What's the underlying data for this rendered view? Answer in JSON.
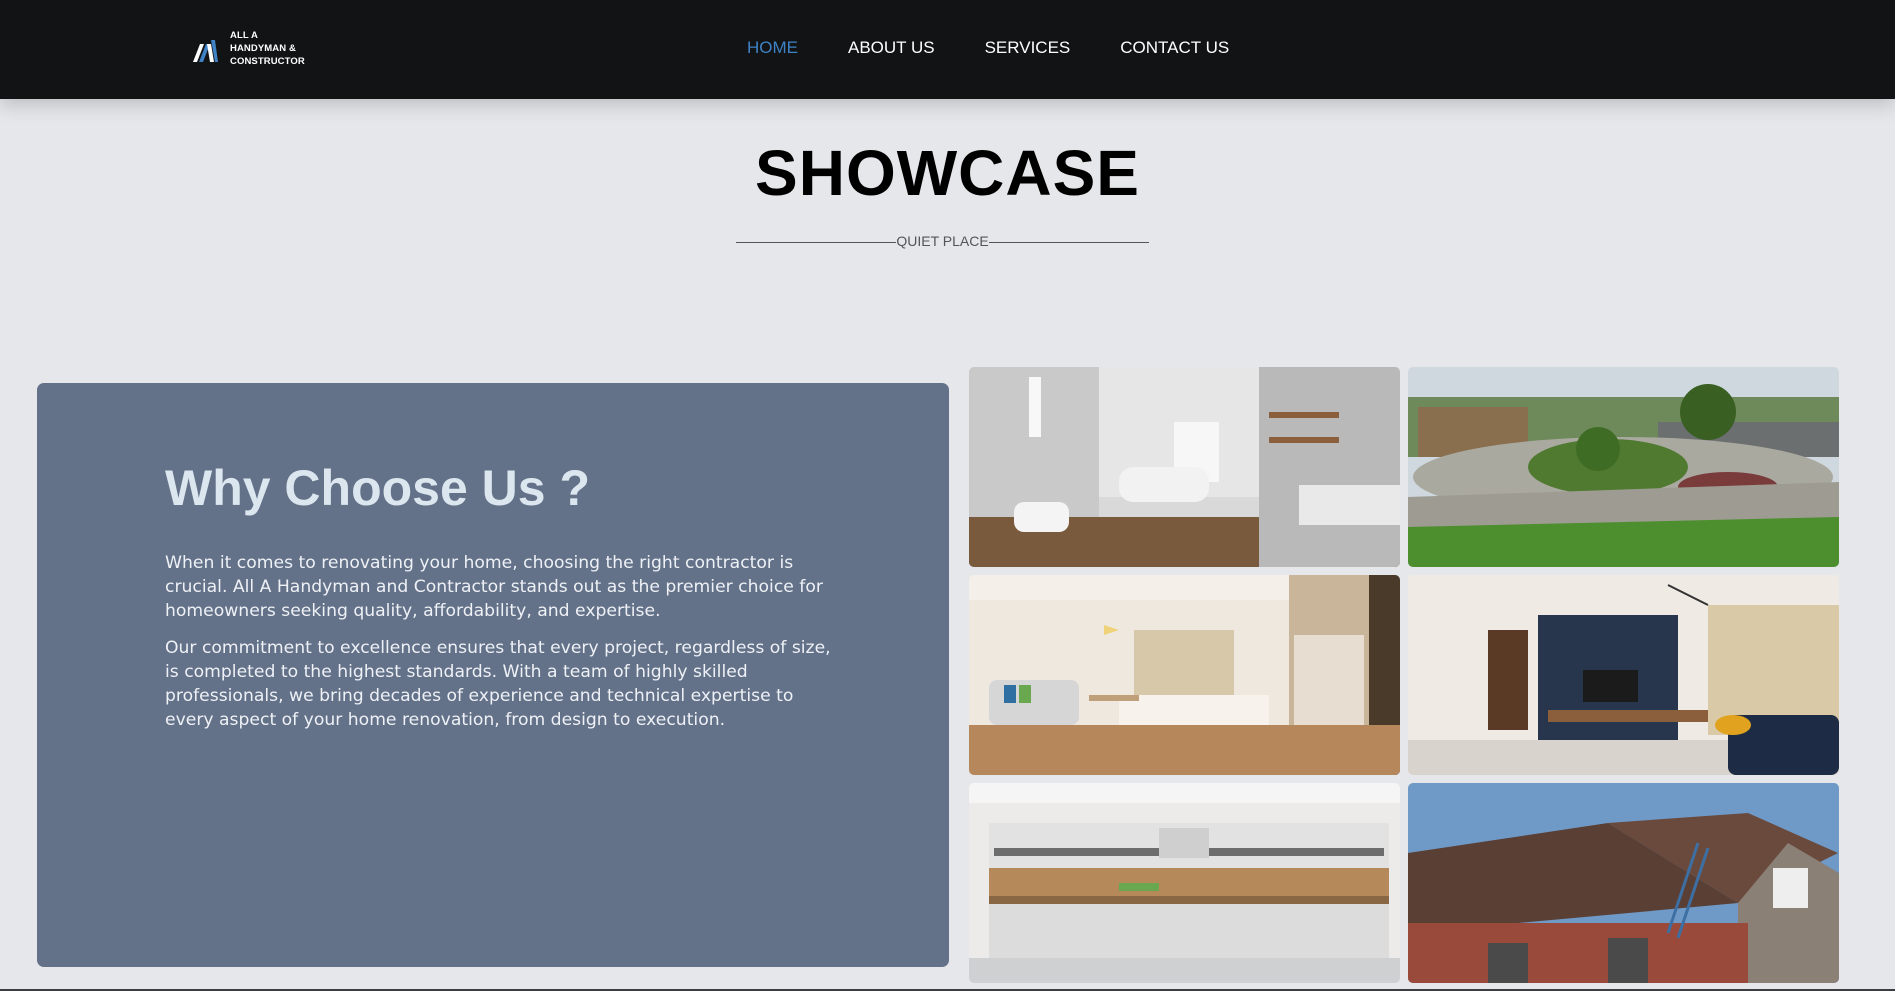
{
  "logo": {
    "lines": [
      "ALL A",
      "HANDYMAN &",
      "CONSTRUCTOR"
    ],
    "icon": "logo-mark-icon"
  },
  "nav": {
    "items": [
      {
        "label": "HOME",
        "active": true
      },
      {
        "label": "ABOUT US",
        "active": false
      },
      {
        "label": "SERVICES",
        "active": false
      },
      {
        "label": "CONTACT US",
        "active": false
      }
    ]
  },
  "showcase": {
    "title": "SHOWCASE",
    "subtitle": "QUIET PLACE"
  },
  "why": {
    "title": "Why Choose Us ?",
    "paragraphs": [
      "When it comes to renovating your home, choosing the right contractor is crucial. All A Handyman and Contractor stands out as the premier choice for homeowners seeking quality, affordability, and expertise.",
      "Our commitment to excellence ensures that every project, regardless of size, is completed to the highest standards. With a team of highly skilled professionals, we bring decades of experience and technical expertise to every aspect of your home renovation, from design to execution."
    ]
  },
  "colors": {
    "navbar": "#121315",
    "active_link": "#3f82c6",
    "page_background": "#e6e7eb",
    "panel": "#637189"
  }
}
